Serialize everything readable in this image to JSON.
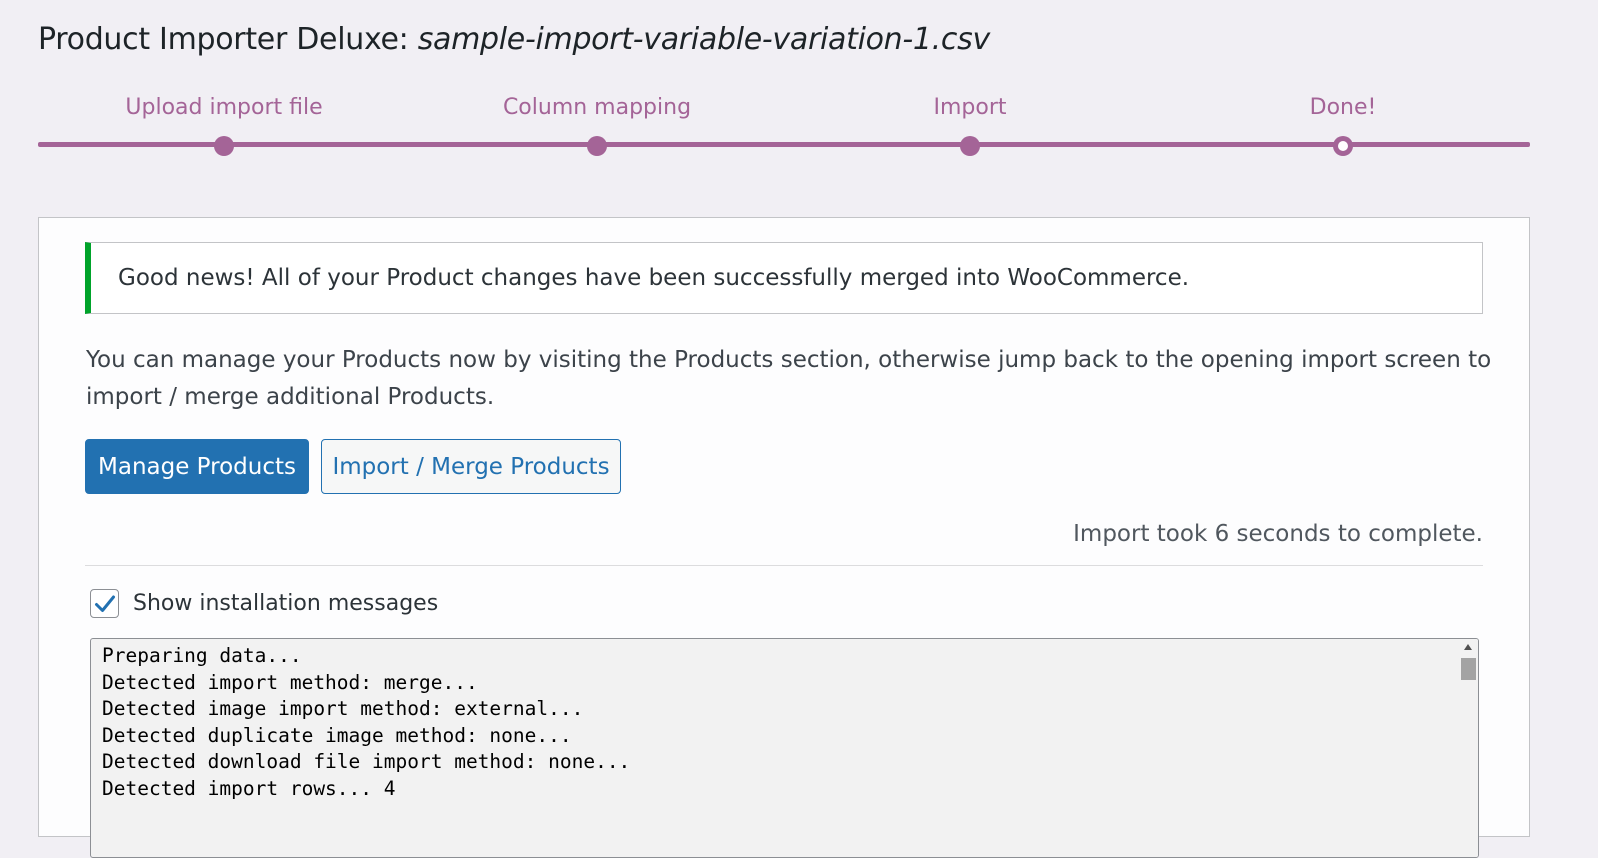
{
  "header": {
    "title_prefix": "Product Importer Deluxe:",
    "file_name": "sample-import-variable-variation-1.csv"
  },
  "steps": [
    {
      "label": "Upload import file",
      "state": "complete"
    },
    {
      "label": "Column mapping",
      "state": "complete"
    },
    {
      "label": "Import",
      "state": "complete"
    },
    {
      "label": "Done!",
      "state": "current"
    }
  ],
  "notice": {
    "text": "Good news! All of your Product changes have been successfully merged into WooCommerce.",
    "color": "#00a32a"
  },
  "intro_text": "You can manage your Products now by visiting the Products section, otherwise jump back to the opening import screen to import / merge additional Products.",
  "buttons": {
    "manage": "Manage Products",
    "import": "Import / Merge Products"
  },
  "duration_text": "Import took 6 seconds to complete.",
  "messages_toggle": {
    "label": "Show installation messages",
    "checked": true
  },
  "log_lines": [
    "Preparing data...",
    "Detected import method: merge...",
    "Detected image import method: external...",
    "Detected duplicate image method: none...",
    "Detected download file import method: none...",
    "Detected import rows... 4"
  ],
  "colors": {
    "accent": "#a46497",
    "primary_button": "#2271b1",
    "success": "#00a32a"
  },
  "icons": {
    "checkbox": "checkmark-icon",
    "scroll_up": "scroll-up-arrow-icon"
  }
}
